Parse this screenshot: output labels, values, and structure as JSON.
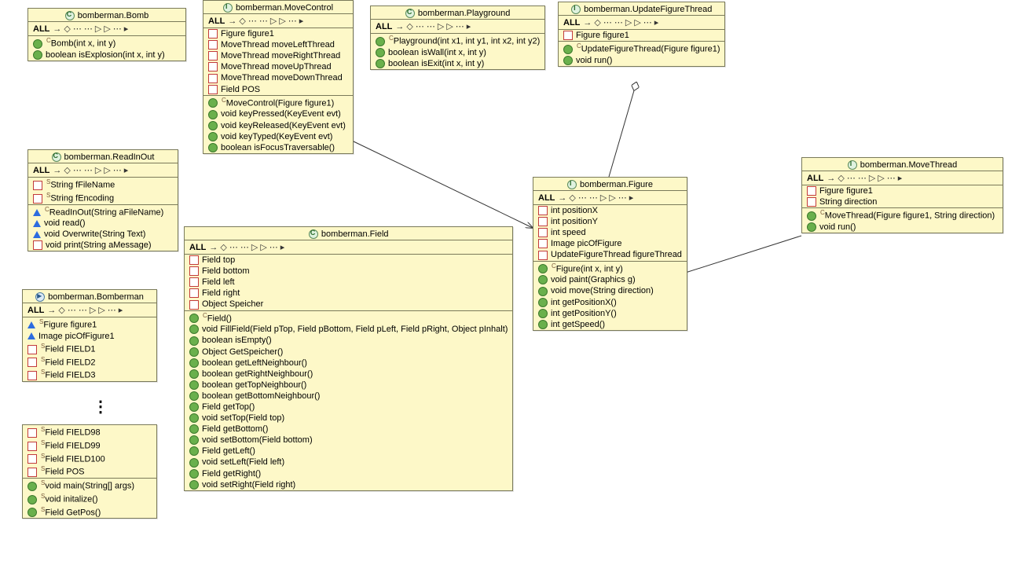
{
  "filter_label": "ALL",
  "classes": {
    "bomb": {
      "title": "bomberman.Bomb",
      "icon": "class",
      "members": [
        {
          "vis": "green",
          "sup": "C",
          "text": "Bomb(int x, int y)"
        },
        {
          "vis": "green",
          "text": "boolean isExplosion(int x, int y)"
        }
      ]
    },
    "readinout": {
      "title": "bomberman.ReadInOut",
      "icon": "class",
      "fields": [
        {
          "vis": "red",
          "sup": "S",
          "text": "String fFileName"
        },
        {
          "vis": "red",
          "sup": "S",
          "text": "String fEncoding"
        }
      ],
      "members": [
        {
          "vis": "blue",
          "sup": "C",
          "text": "ReadInOut(String aFileName)"
        },
        {
          "vis": "blue",
          "text": "void read()"
        },
        {
          "vis": "blue",
          "text": "void Overwrite(String Text)"
        },
        {
          "vis": "redbox",
          "text": "void print(String aMessage)"
        }
      ]
    },
    "bomberman": {
      "title": "bomberman.Bomberman",
      "icon": "run",
      "fields": [
        {
          "vis": "blue",
          "sup": "S",
          "text": "Figure figure1"
        },
        {
          "vis": "blue",
          "text": "Image picOfFigure1"
        },
        {
          "vis": "red",
          "sup": "S",
          "text": "Field FIELD1"
        },
        {
          "vis": "red",
          "sup": "S",
          "text": "Field FIELD2"
        },
        {
          "vis": "red",
          "sup": "S",
          "text": "Field FIELD3"
        }
      ],
      "fields2": [
        {
          "vis": "red",
          "sup": "S",
          "text": "Field FIELD98"
        },
        {
          "vis": "red",
          "sup": "S",
          "text": "Field FIELD99"
        },
        {
          "vis": "red",
          "sup": "S",
          "text": "Field FIELD100"
        },
        {
          "vis": "red",
          "sup": "S",
          "text": "Field POS"
        }
      ],
      "members": [
        {
          "vis": "green",
          "sup": "S",
          "text": "void main(String[] args)"
        },
        {
          "vis": "green",
          "sup": "S",
          "text": "void initalize()"
        },
        {
          "vis": "green",
          "sup": "S",
          "text": "Field GetPos()"
        }
      ]
    },
    "movecontrol": {
      "title": "bomberman.MoveControl",
      "icon": "iface",
      "fields": [
        {
          "vis": "red",
          "text": "Figure figure1"
        },
        {
          "vis": "red",
          "text": "MoveThread moveLeftThread"
        },
        {
          "vis": "red",
          "text": "MoveThread moveRightThread"
        },
        {
          "vis": "red",
          "text": "MoveThread moveUpThread"
        },
        {
          "vis": "red",
          "text": "MoveThread moveDownThread"
        },
        {
          "vis": "red",
          "text": "Field POS"
        }
      ],
      "members": [
        {
          "vis": "green",
          "sup": "C",
          "text": "MoveControl(Figure figure1)"
        },
        {
          "vis": "green",
          "text": "void keyPressed(KeyEvent evt)"
        },
        {
          "vis": "green",
          "text": "void keyReleased(KeyEvent evt)"
        },
        {
          "vis": "green",
          "text": "void keyTyped(KeyEvent evt)"
        },
        {
          "vis": "green",
          "text": "boolean isFocusTraversable()"
        }
      ]
    },
    "playground": {
      "title": "bomberman.Playground",
      "icon": "class",
      "members": [
        {
          "vis": "green",
          "sup": "C",
          "text": "Playground(int x1, int y1, int x2, int y2)"
        },
        {
          "vis": "green",
          "text": "boolean isWall(int x, int y)"
        },
        {
          "vis": "green",
          "text": "boolean isExit(int x, int y)"
        }
      ]
    },
    "updatefigure": {
      "title": "bomberman.UpdateFigureThread",
      "icon": "iface",
      "fields": [
        {
          "vis": "red",
          "text": "Figure figure1"
        }
      ],
      "members": [
        {
          "vis": "green",
          "sup": "C",
          "text": "UpdateFigureThread(Figure figure1)"
        },
        {
          "vis": "green",
          "text": "void run()"
        }
      ]
    },
    "movethread": {
      "title": "bomberman.MoveThread",
      "icon": "iface",
      "fields": [
        {
          "vis": "red",
          "text": "Figure figure1"
        },
        {
          "vis": "red",
          "text": "String direction"
        }
      ],
      "members": [
        {
          "vis": "green",
          "sup": "C",
          "text": "MoveThread(Figure figure1, String direction)"
        },
        {
          "vis": "green",
          "text": "void run()"
        }
      ]
    },
    "figure": {
      "title": "bomberman.Figure",
      "icon": "iface",
      "fields": [
        {
          "vis": "red",
          "text": "int positionX"
        },
        {
          "vis": "red",
          "text": "int positionY"
        },
        {
          "vis": "red",
          "text": "int speed"
        },
        {
          "vis": "red",
          "text": "Image picOfFigure"
        },
        {
          "vis": "red",
          "text": "UpdateFigureThread figureThread"
        }
      ],
      "members": [
        {
          "vis": "green",
          "sup": "C",
          "text": "Figure(int x, int y)"
        },
        {
          "vis": "green",
          "text": "void paint(Graphics g)"
        },
        {
          "vis": "green",
          "text": "void move(String direction)"
        },
        {
          "vis": "green",
          "text": "int getPositionX()"
        },
        {
          "vis": "green",
          "text": "int getPositionY()"
        },
        {
          "vis": "green",
          "text": "int getSpeed()"
        }
      ]
    },
    "field": {
      "title": "bomberman.Field",
      "icon": "class",
      "fields": [
        {
          "vis": "red",
          "text": "Field top"
        },
        {
          "vis": "red",
          "text": "Field bottom"
        },
        {
          "vis": "red",
          "text": "Field left"
        },
        {
          "vis": "red",
          "text": "Field right"
        },
        {
          "vis": "red",
          "text": "Object Speicher"
        }
      ],
      "members": [
        {
          "vis": "green",
          "sup": "C",
          "text": "Field()"
        },
        {
          "vis": "green",
          "text": "void FillField(Field pTop, Field pBottom, Field pLeft, Field pRight, Object pInhalt)"
        },
        {
          "vis": "green",
          "text": "boolean isEmpty()"
        },
        {
          "vis": "green",
          "text": "Object GetSpeicher()"
        },
        {
          "vis": "green",
          "text": "boolean getLeftNeighbour()"
        },
        {
          "vis": "green",
          "text": "boolean getRightNeighbour()"
        },
        {
          "vis": "green",
          "text": "boolean getTopNeighbour()"
        },
        {
          "vis": "green",
          "text": "boolean getBottomNeighbour()"
        },
        {
          "vis": "green",
          "text": "Field getTop()"
        },
        {
          "vis": "green",
          "text": "void setTop(Field top)"
        },
        {
          "vis": "green",
          "text": "Field getBottom()"
        },
        {
          "vis": "green",
          "text": "void setBottom(Field bottom)"
        },
        {
          "vis": "green",
          "text": "Field getLeft()"
        },
        {
          "vis": "green",
          "text": "void setLeft(Field left)"
        },
        {
          "vis": "green",
          "text": "Field getRight()"
        },
        {
          "vis": "green",
          "text": "void setRight(Field right)"
        }
      ]
    }
  }
}
